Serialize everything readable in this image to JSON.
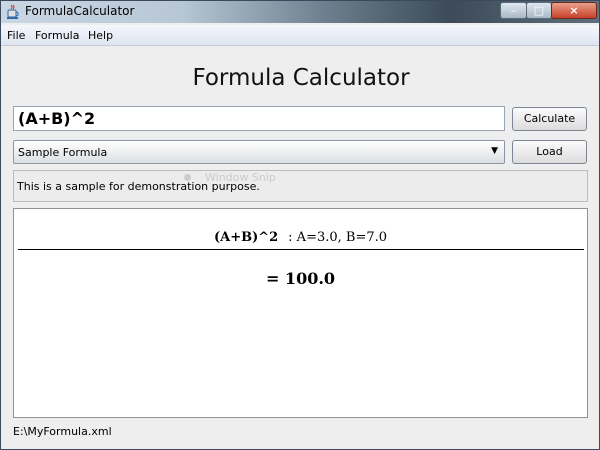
{
  "window": {
    "title": "FormulaCalculator",
    "minimize": "–",
    "maximize": "□",
    "close": "×"
  },
  "menu": [
    "File",
    "Formula",
    "Help"
  ],
  "heading": "Formula Calculator",
  "formula_input": {
    "value": "(A+B)^2"
  },
  "buttons": {
    "calculate": "Calculate",
    "load": "Load"
  },
  "sample_select": {
    "selected": "Sample Formula",
    "arrow": "▼"
  },
  "description": "This is a sample for demonstration purpose.",
  "ghost_overlay": "Window Snip",
  "result": {
    "expression": "(A+B)^2",
    "variables": ": A=3.0, B=7.0",
    "value": "= 100.0"
  },
  "status_path": "E:\\MyFormula.xml"
}
